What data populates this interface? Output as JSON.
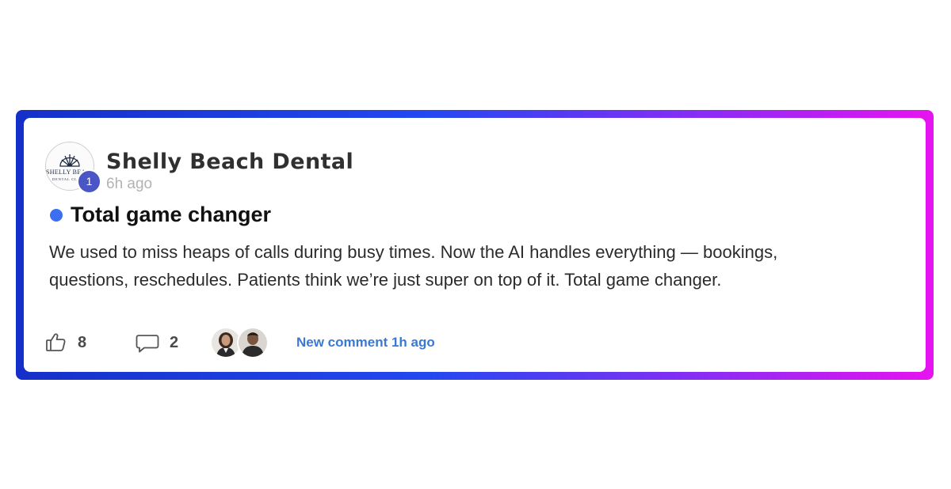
{
  "post": {
    "author": "Shelly Beach Dental",
    "author_logo_text_line1": "SHELLY BEACH",
    "author_logo_text_line2": "DENTAL CLINIC",
    "notification_count": "1",
    "time_ago": "6h ago",
    "title": "Total game changer",
    "body": "We used to miss heaps of calls during busy times. Now the AI handles everything — bookings, questions, reschedules. Patients think we’re just super on top of it. Total game changer.",
    "unread_dot_color": "#3b6ef0"
  },
  "footer": {
    "likes_icon": "thumbs-up-icon",
    "likes": "8",
    "comments_icon": "comment-bubble-icon",
    "comments": "2",
    "participants": [
      "participant-woman",
      "participant-man"
    ],
    "new_comment_text": "New comment 1h ago"
  },
  "colors": {
    "frame_gradient_start": "#1530c8",
    "frame_gradient_end": "#e713f0",
    "badge": "#4a56c5",
    "link": "#3a78d6"
  }
}
